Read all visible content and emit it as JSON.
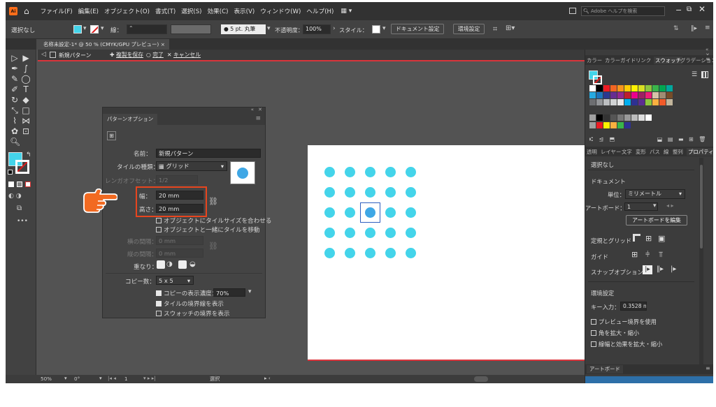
{
  "menubar": {
    "logo": "Ai",
    "items": [
      "ファイル(F)",
      "編集(E)",
      "オブジェクト(O)",
      "書式(T)",
      "選択(S)",
      "効果(C)",
      "表示(V)",
      "ウィンドウ(W)",
      "ヘルプ(H)"
    ],
    "search_placeholder": "Adobe ヘルプを検索"
  },
  "controlbar": {
    "selection": "選択なし",
    "stroke_label": "線：",
    "brush": "5 pt. 丸筆",
    "opacity_label": "不透明度：",
    "opacity_value": "100%",
    "style_label": "スタイル：",
    "doc_setup_button": "ドキュメント設定",
    "prefs_button": "環境設定"
  },
  "document_tab": {
    "title": "名称未設定-1* @ 50 % (CMYK/GPU プレビュー)",
    "close": "×"
  },
  "pattern_bar": {
    "mode_label": "新規パターン",
    "save_copy": "複製を保存",
    "done": "完了",
    "cancel": "キャンセル"
  },
  "pattern_options": {
    "title": "パターンオプション",
    "name_label": "名前：",
    "name_value": "新規パターン",
    "tile_type_label": "タイルの種類：",
    "tile_type_value": "グリッド",
    "brick_offset_label": "レンガオフセット：",
    "brick_offset_value": "1/2",
    "width_label": "幅：",
    "width_value": "20 mm",
    "height_label": "高さ：",
    "height_value": "20 mm",
    "fit_tile_label": "オブジェクトにタイルサイズを合わせる",
    "move_tile_label": "オブジェクトと一緒にタイルを移動",
    "h_spacing_label": "横の間隔：",
    "h_spacing_value": "0 mm",
    "v_spacing_label": "縦の間隔：",
    "v_spacing_value": "0 mm",
    "overlap_label": "重なり：",
    "copies_label": "コピー数：",
    "copies_value": "5 x 5",
    "dim_copies_label": "コピーの表示濃度：",
    "dim_copies_value": "70%",
    "show_tile_edge_label": "タイルの境界線を表示",
    "show_swatch_bounds_label": "スウォッチの境界を表示"
  },
  "artboard": {
    "rows": 5,
    "cols": 5,
    "dot_color": "#44d4ea",
    "selected_dot_color": "#3fa7e5"
  },
  "status_bar": {
    "zoom": "50%",
    "rotation": "0°",
    "artboard_num": "1",
    "tool": "選択"
  },
  "right_panel": {
    "tabs_top": [
      "カラー",
      "カラーガイド",
      "リンク",
      "スウォッチ",
      "グラデーション"
    ],
    "active_tab_top": "スウォッチ",
    "tabs_mid": [
      "透明",
      "レイヤー",
      "文字",
      "変形",
      "パス",
      "線",
      "整列",
      "プロパティ"
    ],
    "active_tab_mid": "プロパティ",
    "no_selection": "選択なし",
    "document_heading": "ドキュメント",
    "unit_label": "単位：",
    "unit_value": "ミリメートル",
    "artboard_label": "アートボード：",
    "artboard_value": "1",
    "edit_artboard_button": "アートボードを編集",
    "rulers_grid_label": "定規とグリッド",
    "guides_label": "ガイド",
    "snap_label": "スナップオプション",
    "prefs_heading": "環境設定",
    "key_increment_label": "キー入力：",
    "key_increment_value": "0.3528 mm",
    "preview_bounds_label": "プレビュー境界を使用",
    "scale_corners_label": "角を拡大・縮小",
    "scale_strokes_label": "線幅と効果を拡大・縮小",
    "bottom_tab": "アートボード",
    "swatch_colors": [
      [
        "#ffffff",
        "#000000",
        "#ec1c24",
        "#f26522",
        "#f7941d",
        "#ffcb05",
        "#fff200",
        "#d7df23",
        "#8dc63f",
        "#39b54a",
        "#00a651",
        "#00a79d"
      ],
      [
        "#27aae1",
        "#1c75bc",
        "#2b388f",
        "#662d91",
        "#92278f",
        "#be1e2d",
        "#ec008c",
        "#9e1f63",
        "#ed1c79",
        "#d7c3a8",
        "#a08c73",
        "#754c29"
      ],
      [
        "#6d6e71",
        "#939598",
        "#bcbec0",
        "#d1d3d4",
        "#e6e7e8",
        "#00aeef",
        "#2e3192",
        "#5c2d91",
        "#8dc63f",
        "#fbb040",
        "#f15a29",
        "#c2b59b"
      ]
    ]
  }
}
